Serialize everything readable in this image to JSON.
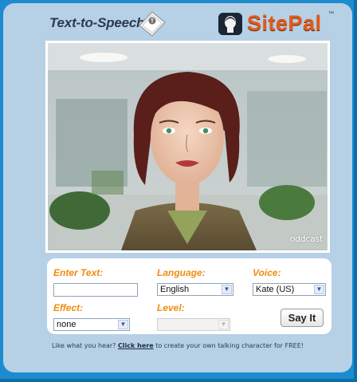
{
  "header": {
    "tts_title": "Text-to-Speech",
    "tts_icon": "speech-key-icon",
    "logo_text": "SitePal",
    "logo_tm": "™",
    "logo_icon": "sitepal-face-icon"
  },
  "stage": {
    "watermark": "oddcast",
    "avatar": "talking-character-avatar"
  },
  "controls": {
    "enter_text_label": "Enter Text:",
    "text_value": "",
    "language_label": "Language:",
    "language_value": "English",
    "voice_label": "Voice:",
    "voice_value": "Kate (US)",
    "effect_label": "Effect:",
    "effect_value": "none",
    "level_label": "Level:",
    "level_value": "",
    "say_button": "Say It"
  },
  "promo": {
    "prefix": "Like what you hear?",
    "link": "Click here",
    "suffix": "to create your own talking character for FREE!"
  },
  "colors": {
    "frame": "#1c8ccf",
    "panel": "#b6d0e6",
    "label": "#f08c0f",
    "logo": "#e05a1a"
  }
}
